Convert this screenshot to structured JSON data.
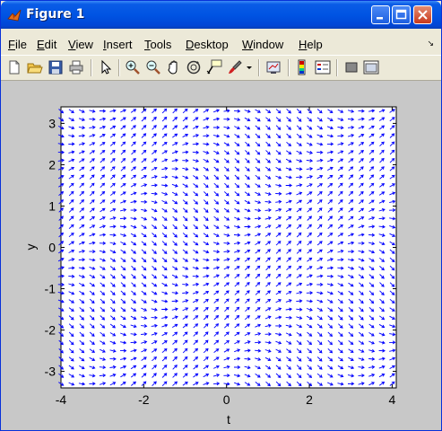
{
  "window": {
    "title": "Figure 1"
  },
  "menu": [
    "File",
    "Edit",
    "View",
    "Insert",
    "Tools",
    "Desktop",
    "Window",
    "Help"
  ],
  "toolbar": {
    "icons": [
      "new-file-icon",
      "open-file-icon",
      "save-icon",
      "print-icon",
      "pointer-icon",
      "zoom-in-icon",
      "zoom-out-icon",
      "pan-icon",
      "rotate-3d-icon",
      "data-cursor-icon",
      "brush-icon",
      "brush-dropdown-icon",
      "link-plot-icon",
      "colorbar-icon",
      "legend-icon",
      "hide-plot-tools-icon",
      "show-plot-tools-icon"
    ]
  },
  "chart_data": {
    "type": "quiver",
    "xlabel": "t",
    "ylabel": "y",
    "xlim": [
      -4,
      4.1
    ],
    "ylim": [
      -3.4,
      3.4
    ],
    "xticks": [
      "-4",
      "-2",
      "0",
      "2",
      "4"
    ],
    "yticks": [
      "-3",
      "-2",
      "-1",
      "0",
      "1",
      "2",
      "3"
    ],
    "grid": false,
    "arrow_color": "#0000ff",
    "field": "dy/dt = sin(t - y)",
    "t_range": [
      -4,
      4
    ],
    "y_range": [
      -3.3,
      3.3
    ],
    "samples": [
      33,
      34
    ]
  }
}
